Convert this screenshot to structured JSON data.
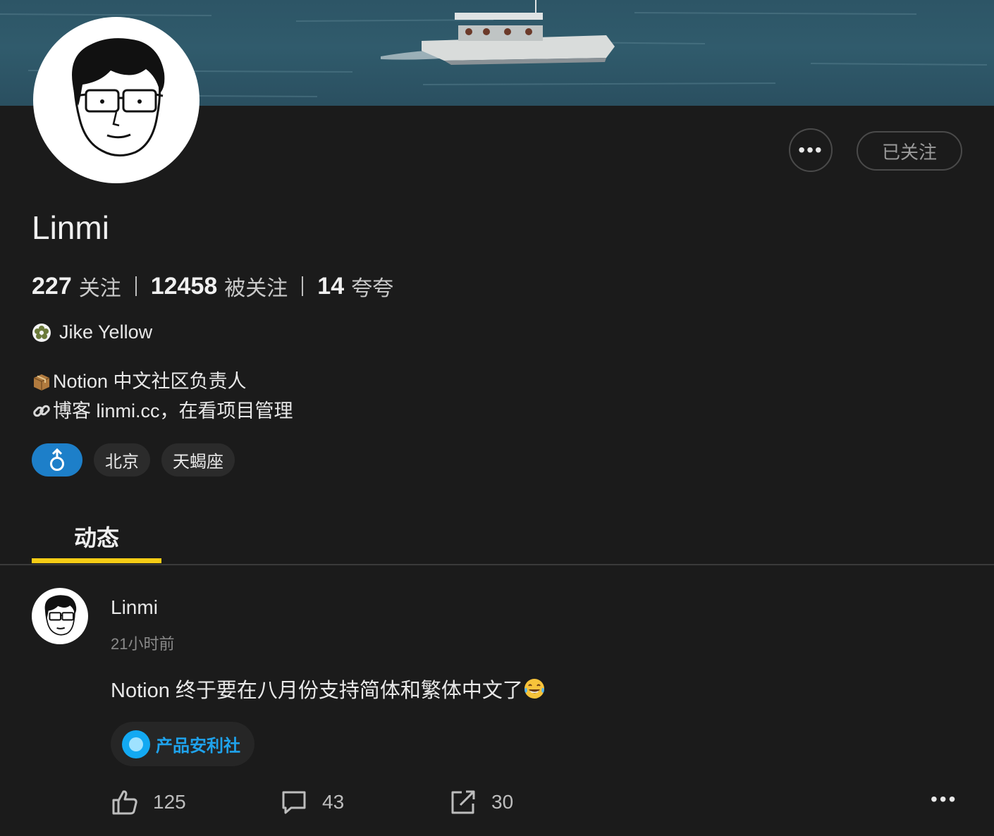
{
  "profile": {
    "name": "Linmi",
    "follow_button": "已关注",
    "more_button": "•••",
    "stats": {
      "following_count": "227",
      "following_label": "关注",
      "followers_count": "12458",
      "followers_label": "被关注",
      "kudos_count": "14",
      "kudos_label": "夸夸"
    },
    "badge": "Jike Yellow",
    "bio": [
      "Notion 中文社区负责人",
      "博客 linmi.cc，在看项目管理"
    ],
    "tags": {
      "gender": "♂",
      "city": "北京",
      "zodiac": "天蝎座"
    }
  },
  "tabs": {
    "active": "动态"
  },
  "post": {
    "author": "Linmi",
    "time": "21小时前",
    "text": "Notion 终于要在八月份支持简体和繁体中文了",
    "topic": "产品安利社",
    "likes": "125",
    "comments": "43",
    "shares": "30",
    "more": "•••"
  },
  "colors": {
    "background": "#1b1b1b",
    "accent_yellow": "#f6cc15",
    "topic_blue": "#1fa3ec",
    "gender_blue": "#1d7fc9"
  }
}
